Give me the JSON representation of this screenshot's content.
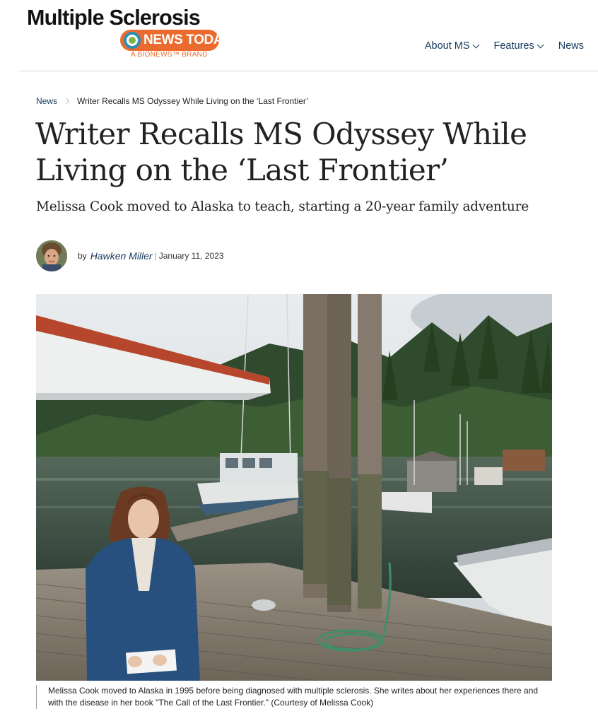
{
  "brand": {
    "logo_title": "Multiple Sclerosis",
    "logo_news": "NEWS TODAY",
    "logo_tm": "TM",
    "logo_sub": "A BIONEWS™ BRAND",
    "colors": {
      "orange": "#ea6b2d",
      "navy": "#173a5e",
      "globe_blue": "#2e8db5",
      "globe_green": "#7ab648"
    }
  },
  "nav": {
    "items": [
      {
        "label": "About MS",
        "icon": "chevron-down-icon"
      },
      {
        "label": "Features",
        "icon": "chevron-down-icon"
      },
      {
        "label": "News"
      }
    ]
  },
  "breadcrumb": {
    "parent": "News",
    "current": "Writer Recalls MS Odyssey While Living on the ‘Last Frontier’"
  },
  "article": {
    "title": "Writer Recalls MS Odyssey While Living on the ‘Last Frontier’",
    "subtitle": "Melissa Cook moved to Alaska to teach, starting a 20-year family adventure",
    "by": "by",
    "author": "Hawken Miller",
    "separator": "|",
    "date": "January 11, 2023",
    "caption": "Melissa Cook moved to Alaska in 1995 before being diagnosed with multiple sclerosis. She writes about her experiences there and with the disease in her book \"The Call of the Last Frontier.\" (Courtesy of Melissa Cook)"
  }
}
